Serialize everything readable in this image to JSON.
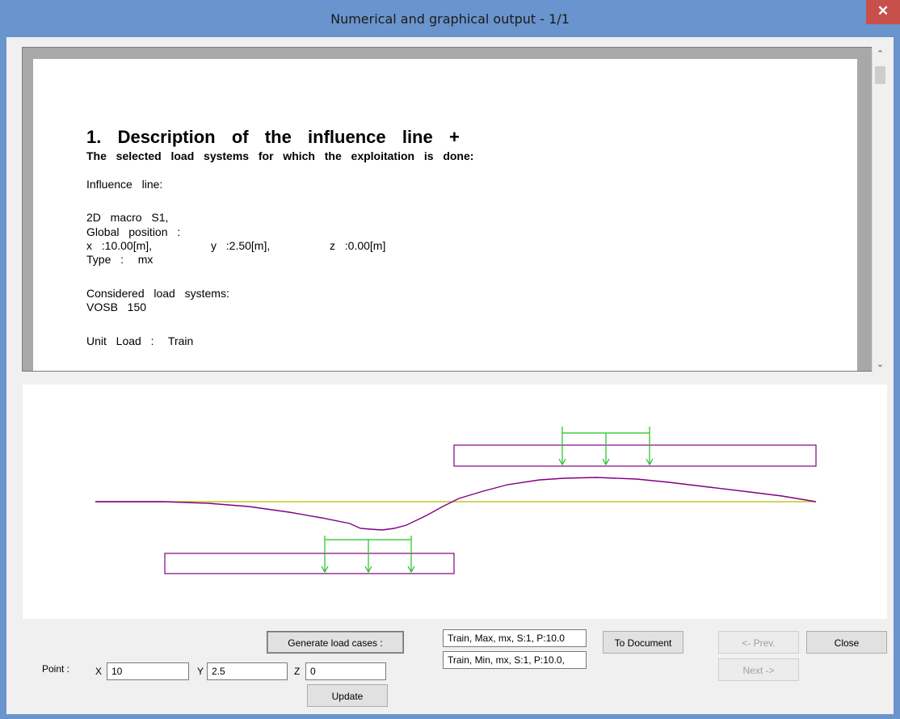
{
  "window": {
    "title": "Numerical and graphical output - 1/1",
    "close_glyph": "✕"
  },
  "report": {
    "heading": "1.  Description  of  the  influence  line  +",
    "subheading": "The  selected  load  systems  for  which  the  exploitation  is  done:",
    "influence_label": "Influence  line:",
    "macro": "2D  macro  S1,",
    "position_label": "Global  position  :",
    "x": "x  :10.00[m],",
    "y": "y  :2.50[m],",
    "z": "z  :0.00[m]",
    "type": "Type  :   mx",
    "considered_label": "Considered  load  systems:",
    "load_system": "VOSB  150",
    "unit_load": "Unit  Load  :   Train"
  },
  "scrollbar": {
    "up_glyph": "⌃",
    "down_glyph": "⌄"
  },
  "graph": {
    "line_color": "#800080",
    "axis_color": "#b8b800",
    "load_color": "#22c022",
    "start_color": "#c02020"
  },
  "controls": {
    "generate_label": "Generate load cases :",
    "case_max": "Train, Max, mx, S:1, P:10.0",
    "case_min": "Train, Min, mx, S:1, P:10.0,",
    "to_document_label": "To Document",
    "prev_label": "<- Prev.",
    "next_label": "Next ->",
    "close_label": "Close",
    "point_label": "Point :",
    "x_label": "X",
    "x_value": "10",
    "y_label": "Y",
    "y_value": "2.5",
    "z_label": "Z",
    "z_value": "0",
    "update_label": "Update"
  }
}
